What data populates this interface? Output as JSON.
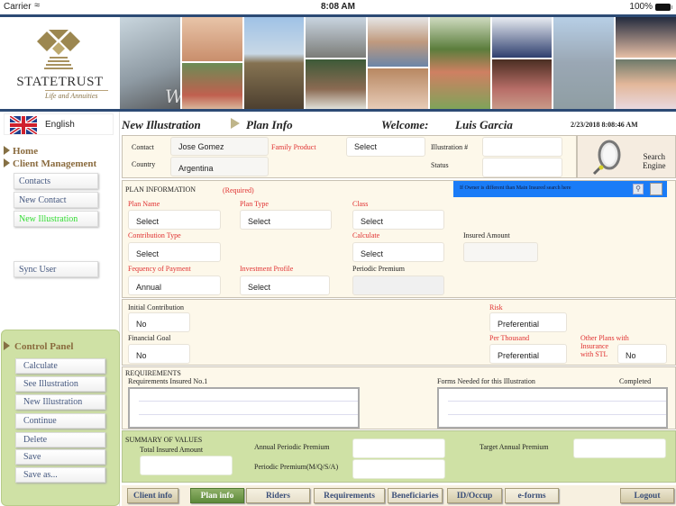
{
  "status_bar": {
    "carrier": "Carrier",
    "time": "8:08 AM",
    "battery": "100%"
  },
  "header": {
    "brand": "StateTrust",
    "tagline": "Life and Annuities",
    "banner_text": "Welcome"
  },
  "sidebar": {
    "language": "English",
    "nav": [
      {
        "label": "Home"
      },
      {
        "label": "Client Management"
      }
    ],
    "client_buttons": [
      {
        "label": "Contacts",
        "active": false
      },
      {
        "label": "New Contact",
        "active": false
      },
      {
        "label": "New Illustration",
        "active": true
      }
    ],
    "sync_button": "Sync User",
    "control_panel": {
      "title": "Control Panel",
      "buttons": [
        {
          "label": "Calculate"
        },
        {
          "label": "See Illustration"
        },
        {
          "label": "New Illustration"
        },
        {
          "label": "Continue"
        },
        {
          "label": "Delete"
        },
        {
          "label": "Save"
        },
        {
          "label": "Save as..."
        }
      ]
    }
  },
  "title_row": {
    "section": "New Illustration",
    "page": "Plan Info",
    "welcome_label": "Welcome:",
    "user": "Luis Garcia",
    "datetime": "2/23/2018 8:08:46 AM"
  },
  "contact_panel": {
    "contact_label": "Contact",
    "contact_value": "Jose Gomez",
    "country_label": "Country",
    "country_value": "Argentina",
    "family_product_label": "Family Product",
    "family_product_value": "Select",
    "illustration_label": "Illustration #",
    "illustration_value": "",
    "status_label": "Status",
    "status_value": ""
  },
  "search_engine": {
    "label_line1": "Search",
    "label_line2": "Engine"
  },
  "plan_info": {
    "title": "PLAN INFORMATION",
    "required": "(Required)",
    "owner_bar_text": "If Owner is different than Main Insured search here",
    "fields": {
      "plan_name": {
        "label": "Plan Name",
        "value": "Select"
      },
      "plan_type": {
        "label": "Plan Type",
        "value": "Select"
      },
      "class": {
        "label": "Class",
        "value": "Select"
      },
      "contribution_type": {
        "label": "Contribution Type",
        "value": "Select"
      },
      "calculate": {
        "label": "Calculate",
        "value": "Select"
      },
      "insured_amount": {
        "label": "Insured Amount",
        "value": ""
      },
      "frequency": {
        "label": "Fequency of Payment",
        "value": "Annual"
      },
      "investment_profile": {
        "label": "Investment Profile",
        "value": "Select"
      },
      "periodic_premium": {
        "label": "Periodic Premium",
        "value": ""
      }
    }
  },
  "extra_info": {
    "initial_contribution": {
      "label": "Initial Contribution",
      "value": "No"
    },
    "financial_goal": {
      "label": "Financial Goal",
      "value": "No"
    },
    "risk": {
      "label": "Risk",
      "value": "Preferential"
    },
    "per_thousand": {
      "label": "Per Thousand",
      "value": "Preferential"
    },
    "other_plans": {
      "label_line1": "Other Plans with",
      "label_line2": "Insurance",
      "label_line3": "with STL",
      "value": "No"
    }
  },
  "requirements": {
    "title": "REQUIREMENTS",
    "insured_label": "Requirements Insured No.1",
    "forms_label": "Forms Needed for this Illustration",
    "completed_label": "Completed"
  },
  "summary": {
    "title": "SUMMARY OF VALUES",
    "total_insured_label": "Total Insured Amount",
    "total_insured_value": "",
    "annual_periodic_label": "Annual Periodic Premium",
    "annual_periodic_value": "",
    "periodic_mqsa_label": "Periodic Premium(M/Q/S/A)",
    "periodic_mqsa_value": "",
    "target_annual_label": "Target Annual Premium",
    "target_annual_value": ""
  },
  "tabs": [
    {
      "label": "Client info",
      "active": false
    },
    {
      "label": "Plan info",
      "active": true
    },
    {
      "label": "Riders",
      "active": false
    },
    {
      "label": "Requirements",
      "active": false
    },
    {
      "label": "Beneficiaries",
      "active": false
    },
    {
      "label": "ID/Occup",
      "active": false
    },
    {
      "label": "e-forms",
      "active": false
    }
  ],
  "logout": "Logout",
  "colors": {
    "accent_blue": "#1a7cf7",
    "panel_cream": "#fdf8ea",
    "panel_green": "#cfe1a5",
    "required_red": "#e03030",
    "header_navy": "#2c4a74",
    "active_green": "#33dd33"
  }
}
